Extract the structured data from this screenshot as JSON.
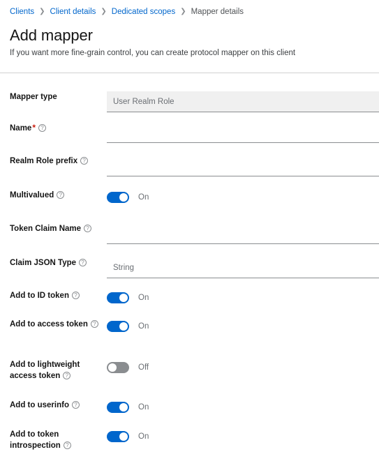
{
  "breadcrumb": {
    "separator": "❯",
    "items": [
      {
        "label": "Clients",
        "link": true
      },
      {
        "label": "Client details",
        "link": true
      },
      {
        "label": "Dedicated scopes",
        "link": true
      },
      {
        "label": "Mapper details",
        "link": false
      }
    ]
  },
  "header": {
    "title": "Add mapper",
    "subtitle": "If you want more fine-grain control, you can create protocol mapper on this client"
  },
  "help_glyph": "?",
  "required_marker": "*",
  "colors": {
    "link": "#0066cc",
    "toggle_on": "#0066cc",
    "toggle_off": "#8a8d90",
    "required": "#c9190b",
    "readonly_bg": "#f0f0f0"
  },
  "fields": [
    {
      "label": "Mapper type",
      "help": false,
      "required": false,
      "type": "text-readonly",
      "value": "User Realm Role",
      "placeholder": ""
    },
    {
      "label": "Name",
      "help": true,
      "required": true,
      "type": "text",
      "value": "",
      "placeholder": ""
    },
    {
      "label": "Realm Role prefix",
      "help": true,
      "required": false,
      "type": "text",
      "value": "",
      "placeholder": ""
    },
    {
      "label": "Multivalued",
      "help": true,
      "required": false,
      "type": "toggle",
      "state": "on",
      "state_label": "On"
    },
    {
      "label": "Token Claim Name",
      "help": true,
      "required": false,
      "type": "text",
      "value": "",
      "placeholder": ""
    },
    {
      "label": "Claim JSON Type",
      "help": true,
      "required": false,
      "type": "text",
      "value": "",
      "placeholder": "String"
    },
    {
      "label": "Add to ID token",
      "help": true,
      "required": false,
      "type": "toggle",
      "state": "on",
      "state_label": "On"
    },
    {
      "label": "Add to access token",
      "help": true,
      "required": false,
      "type": "toggle",
      "state": "on",
      "state_label": "On"
    },
    {
      "label": "Add to lightweight access token",
      "help": true,
      "required": false,
      "type": "toggle",
      "state": "off",
      "state_label": "Off"
    },
    {
      "label": "Add to userinfo",
      "help": true,
      "required": false,
      "type": "toggle",
      "state": "on",
      "state_label": "On"
    },
    {
      "label": "Add to token introspection",
      "help": true,
      "required": false,
      "type": "toggle",
      "state": "on",
      "state_label": "On"
    }
  ]
}
